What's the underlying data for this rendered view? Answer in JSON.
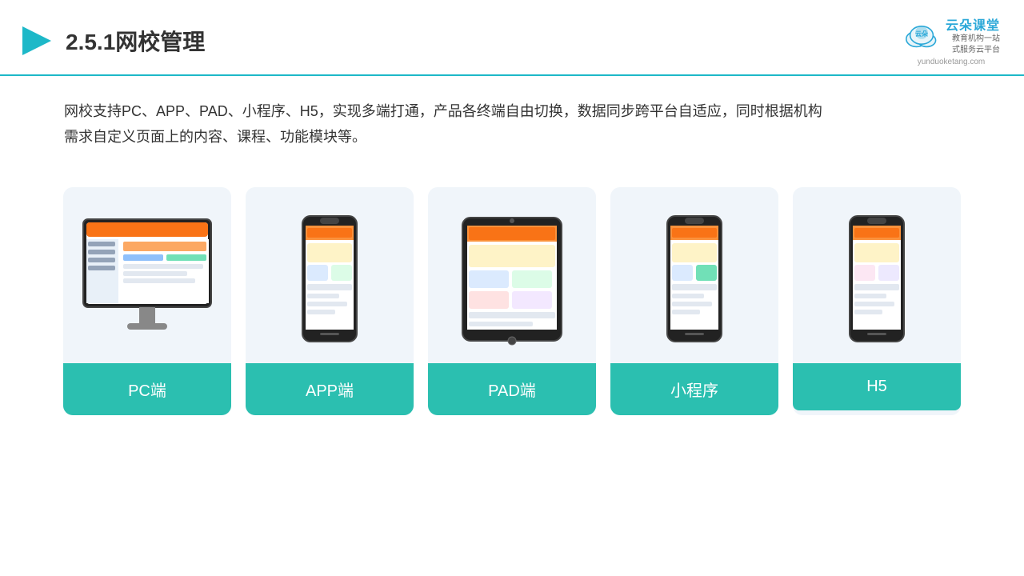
{
  "header": {
    "section_number": "2.5.1",
    "title": "网校管理",
    "brand": {
      "name": "云朵课堂",
      "url": "yunduoketang.com",
      "tagline": "教育机构一站\n式服务云平台"
    }
  },
  "description": {
    "text": "网校支持PC、APP、PAD、小程序、H5，实现多端打通，产品各终端自由切换，数据同步跨平台自适应，同时根据机构需求自定义页面上的内容、课程、功能模块等。"
  },
  "cards": [
    {
      "id": "pc",
      "label": "PC端",
      "device_type": "monitor"
    },
    {
      "id": "app",
      "label": "APP端",
      "device_type": "phone"
    },
    {
      "id": "pad",
      "label": "PAD端",
      "device_type": "tablet"
    },
    {
      "id": "mini",
      "label": "小程序",
      "device_type": "phone"
    },
    {
      "id": "h5",
      "label": "H5",
      "device_type": "phone"
    }
  ],
  "colors": {
    "accent": "#2bbfb0",
    "header_line": "#1db8c8",
    "card_bg": "#f0f5fa",
    "text_dark": "#333333",
    "brand_blue": "#2ba8d8"
  }
}
